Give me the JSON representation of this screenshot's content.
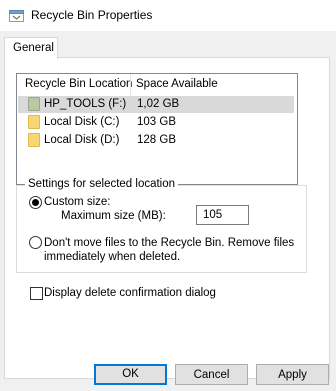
{
  "window": {
    "title": "Recycle Bin Properties",
    "icon": "recycle-bin-icon"
  },
  "tabs": [
    {
      "label": "General",
      "selected": true
    }
  ],
  "locations": {
    "columns": [
      "Recycle Bin Location",
      "Space Available"
    ],
    "rows": [
      {
        "name": "HP_TOOLS (F:)",
        "space": "1,02 GB",
        "selected": true,
        "icon": "drive-icon"
      },
      {
        "name": "Local Disk (C:)",
        "space": "103 GB",
        "selected": false,
        "icon": "folder-drive-icon"
      },
      {
        "name": "Local Disk (D:)",
        "space": "128 GB",
        "selected": false,
        "icon": "folder-drive-icon"
      }
    ]
  },
  "settings": {
    "group_label": "Settings for selected location",
    "custom_size_label": "Custom size:",
    "custom_size_selected": true,
    "max_size_label": "Maximum size (MB):",
    "max_size_value": "105",
    "dont_move_line1": "Don't move files to the Recycle Bin. Remove files",
    "dont_move_line2": "immediately when deleted.",
    "dont_move_selected": false
  },
  "confirm": {
    "label": "Display delete confirmation dialog",
    "checked": false
  },
  "buttons": {
    "ok": "OK",
    "cancel": "Cancel",
    "apply": "Apply"
  },
  "colors": {
    "accent": "#0078d7",
    "selection": "#d9d9d9",
    "dialog_bg": "#f0f0f0"
  }
}
